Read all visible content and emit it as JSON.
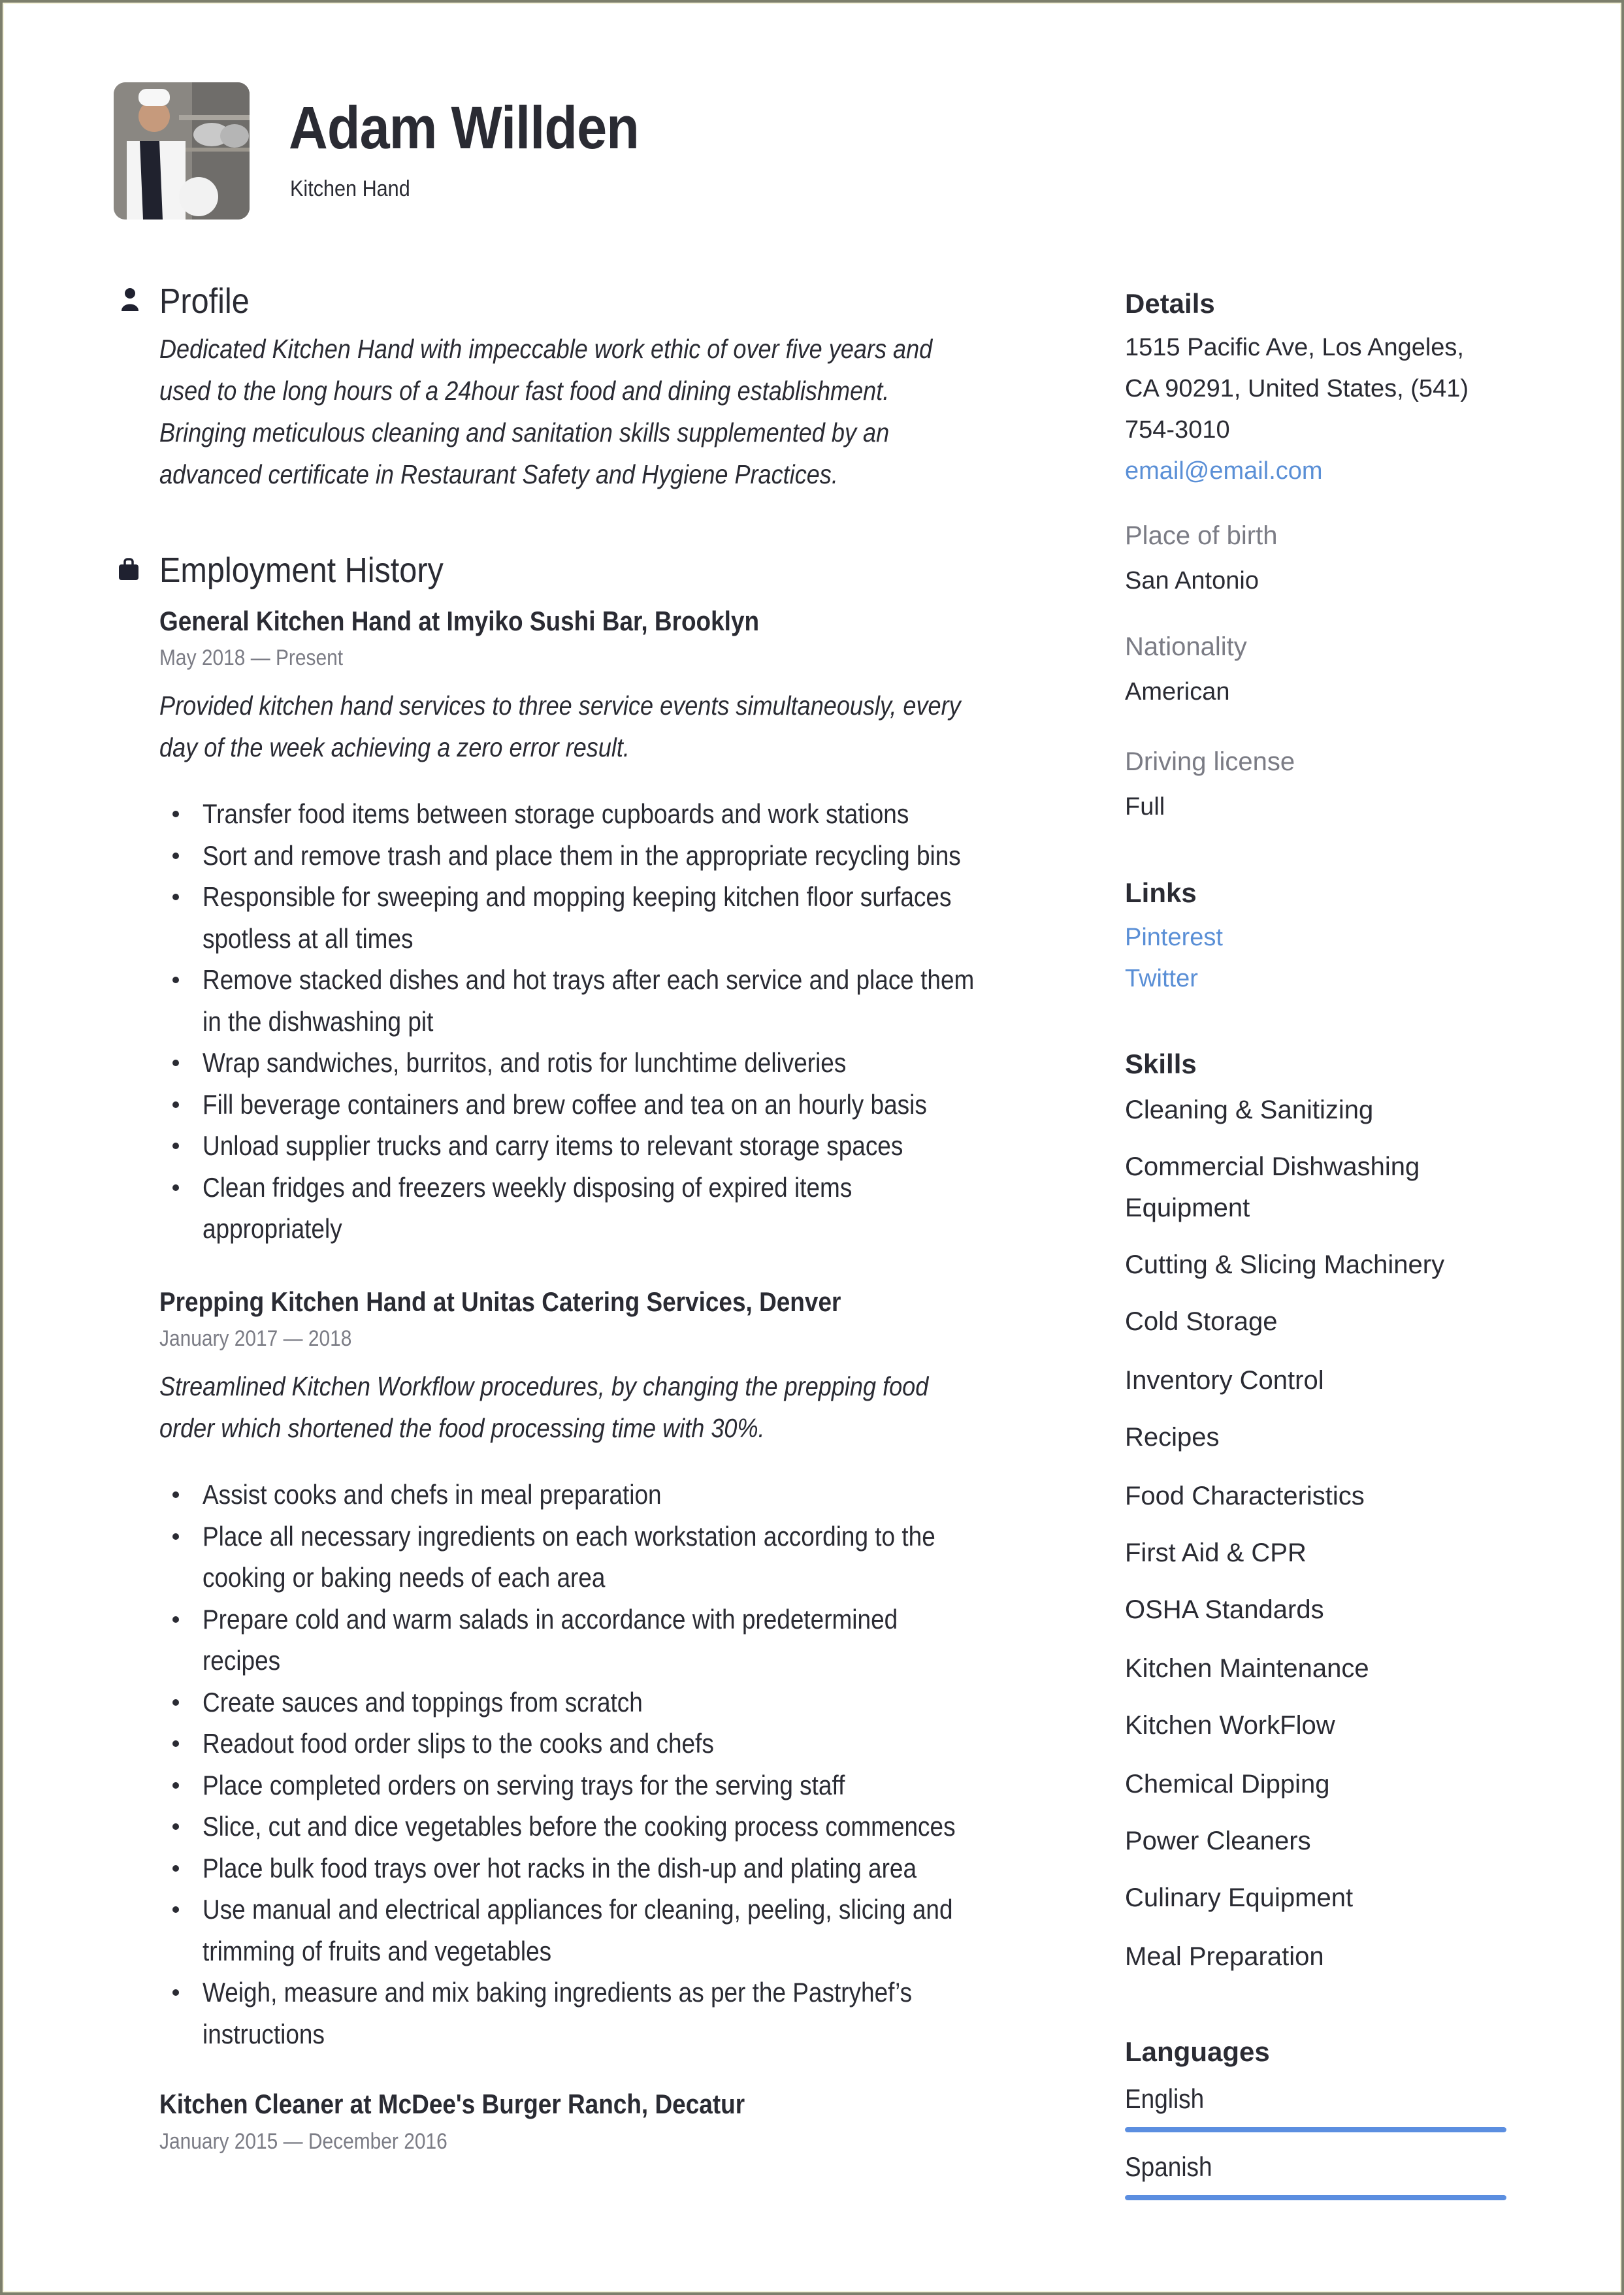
{
  "header": {
    "name": "Adam Willden",
    "title": "Kitchen Hand",
    "photo_alt": "chef-portrait"
  },
  "profile": {
    "heading": "Profile",
    "icon": "person-icon",
    "lines": [
      "Dedicated Kitchen Hand with impeccable work ethic of over five years and",
      "used to the long hours of a 24hour fast food and dining establishment.",
      "Bringing meticulous cleaning and sanitation skills supplemented by an",
      "advanced certificate in Restaurant Safety and Hygiene Practices."
    ]
  },
  "employment": {
    "heading": "Employment History",
    "icon": "briefcase-icon",
    "jobs": [
      {
        "title": "General Kitchen Hand at  Imyiko Sushi Bar, Brooklyn",
        "dates": "May 2018 — Present",
        "summary_lines": [
          "Provided kitchen hand services to three service events simultaneously, every",
          "day of the week achieving a zero error result."
        ],
        "bullets": [
          [
            "Transfer food items between storage cupboards and work stations"
          ],
          [
            "Sort and remove trash and place them in the appropriate recycling bins"
          ],
          [
            "Responsible for sweeping and mopping keeping kitchen floor surfaces",
            "spotless at all times"
          ],
          [
            "Remove stacked dishes and hot trays after each service and place them",
            "in the dishwashing pit"
          ],
          [
            "Wrap sandwiches, burritos, and rotis for lunchtime deliveries"
          ],
          [
            "Fill beverage containers and brew coffee and tea on an hourly basis"
          ],
          [
            "Unload supplier trucks and carry items to relevant storage spaces"
          ],
          [
            "Clean fridges and freezers weekly disposing of expired items",
            "appropriately"
          ]
        ]
      },
      {
        "title": "Prepping Kitchen Hand at  Unitas Catering Services, Denver",
        "dates": "January 2017 — 2018",
        "summary_lines": [
          "Streamlined Kitchen Workflow procedures, by changing the prepping food",
          "order which shortened the food processing time with 30%."
        ],
        "bullets": [
          [
            "Assist cooks and chefs in meal preparation"
          ],
          [
            "Place all necessary ingredients on each workstation according to the",
            "cooking or baking needs of each area"
          ],
          [
            "Prepare cold and warm salads in accordance with predetermined",
            "recipes"
          ],
          [
            "Create sauces and toppings from scratch"
          ],
          [
            "Readout food order slips to the cooks and chefs"
          ],
          [
            "Place completed orders on serving trays for the serving staff"
          ],
          [
            "Slice, cut and dice vegetables before the cooking process commences"
          ],
          [
            "Place bulk food trays over hot racks in the dish-up and plating area"
          ],
          [
            "Use manual and electrical appliances for cleaning, peeling, slicing and",
            "trimming of fruits and vegetables"
          ],
          [
            "Weigh, measure and mix baking ingredients as per the Pastryhef’s",
            "instructions"
          ]
        ]
      },
      {
        "title": "Kitchen Cleaner at  McDee's Burger Ranch, Decatur",
        "dates": "January 2015 — December 2016",
        "summary_lines": [],
        "bullets": []
      }
    ]
  },
  "details": {
    "heading": "Details",
    "address_lines": [
      "1515 Pacific Ave, Los Angeles,",
      "CA 90291, United States, (541)",
      "754-3010"
    ],
    "email": "email@email.com",
    "place_of_birth_label": "Place of birth",
    "place_of_birth": "San Antonio",
    "nationality_label": "Nationality",
    "nationality": "American",
    "driving_license_label": "Driving license",
    "driving_license": "Full"
  },
  "links": {
    "heading": "Links",
    "items": [
      "Pinterest",
      "Twitter"
    ]
  },
  "skills": {
    "heading": "Skills",
    "items": [
      [
        "Cleaning & Sanitizing"
      ],
      [
        "Commercial Dishwashing",
        "Equipment"
      ],
      [
        "Cutting & Slicing Machinery"
      ],
      [
        "Cold Storage"
      ],
      [
        "Inventory Control"
      ],
      [
        "Recipes"
      ],
      [
        "Food Characteristics"
      ],
      [
        "First Aid & CPR"
      ],
      [
        "OSHA Standards"
      ],
      [
        "Kitchen Maintenance"
      ],
      [
        "Kitchen WorkFlow"
      ],
      [
        "Chemical Dipping"
      ],
      [
        "Power Cleaners"
      ],
      [
        "Culinary Equipment"
      ],
      [
        "Meal Preparation"
      ]
    ]
  },
  "languages": {
    "heading": "Languages",
    "items": [
      {
        "name": "English",
        "level": 1.0
      },
      {
        "name": "Spanish",
        "level": 1.0
      }
    ]
  },
  "colors": {
    "text": "#2a2b33",
    "muted": "#7b7c85",
    "link": "#5a8fd6",
    "bar": "#5b8ee0",
    "frame": "#7d7f6c"
  }
}
